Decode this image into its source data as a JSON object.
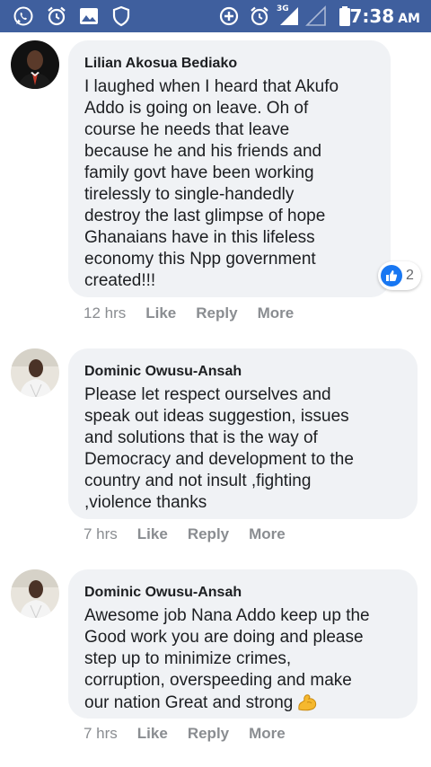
{
  "status_bar": {
    "network_label": "3G",
    "time": "7:38",
    "ampm": "AM",
    "icons": [
      "whatsapp-icon",
      "alarm-icon",
      "gallery-icon",
      "shield-icon",
      "data-saver-icon",
      "alarm-icon",
      "signal-icon",
      "signal-empty-icon",
      "battery-icon"
    ]
  },
  "comments": [
    {
      "author": "Lilian Akosua Bediako",
      "text": "I laughed when I heard that Akufo\nAddo is going on leave. Oh of\ncourse he needs that leave\nbecause he and his friends and\nfamily govt have been working\ntirelessly to single-handedly\ndestroy the last glimpse of hope\nGhanaians have in this lifeless\neconomy this Npp government\ncreated!!!",
      "reaction_count": "2",
      "time": "12 hrs",
      "like": "Like",
      "reply": "Reply",
      "more": "More"
    },
    {
      "author": "Dominic Owusu-Ansah",
      "text": "Please let respect ourselves and\nspeak out ideas suggestion, issues\nand solutions that is the way of\nDemocracy and development to the\ncountry and not insult ,fighting\n,violence thanks",
      "time": "7 hrs",
      "like": "Like",
      "reply": "Reply",
      "more": "More"
    },
    {
      "author": "Dominic Owusu-Ansah",
      "text": "Awesome job Nana Addo keep up the\nGood work you are doing and please\nstep up to minimize crimes,\ncorruption, overspeeding and make\nour nation Great and strong",
      "emoji": "flexed-biceps-icon",
      "time": "7 hrs",
      "like": "Like",
      "reply": "Reply",
      "more": "More"
    }
  ],
  "colors": {
    "status_bar": "#3f5f9e",
    "bubble": "#f0f2f5",
    "like_blue": "#1877f2",
    "action_gray": "#8a8d91"
  }
}
